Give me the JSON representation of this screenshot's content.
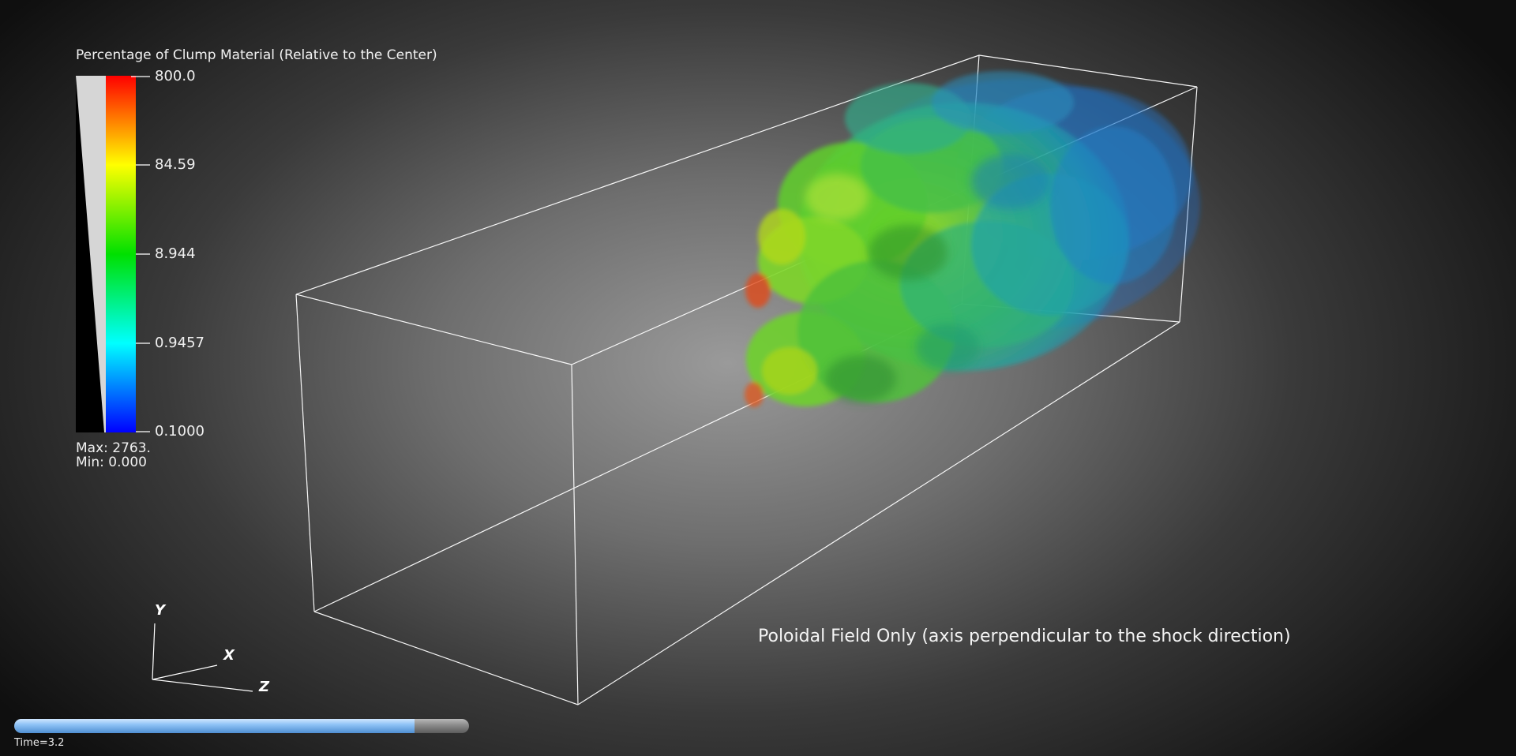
{
  "legend": {
    "title": "Percentage of Clump Material (Relative to the Center)",
    "ticks": [
      "800.0",
      "84.59",
      "8.944",
      "0.9457",
      "0.1000"
    ],
    "max_text": "Max:  2763.",
    "min_text": "Min:  0.000"
  },
  "caption": "Poloidal Field Only (axis perpendicular to the shock direction)",
  "axes": {
    "y": "Y",
    "x": "X",
    "z": "Z"
  },
  "time": {
    "label": "Time=3.2",
    "progress": 0.88
  },
  "colors": {
    "background_center": "#9a9a9a",
    "background_edge": "#0f0f0f",
    "box_lines": "#ffffff",
    "colormap": [
      "#ff0000",
      "#ffff00",
      "#00e000",
      "#00ffff",
      "#0000ff"
    ],
    "time_fill": "#8fc3f6"
  }
}
